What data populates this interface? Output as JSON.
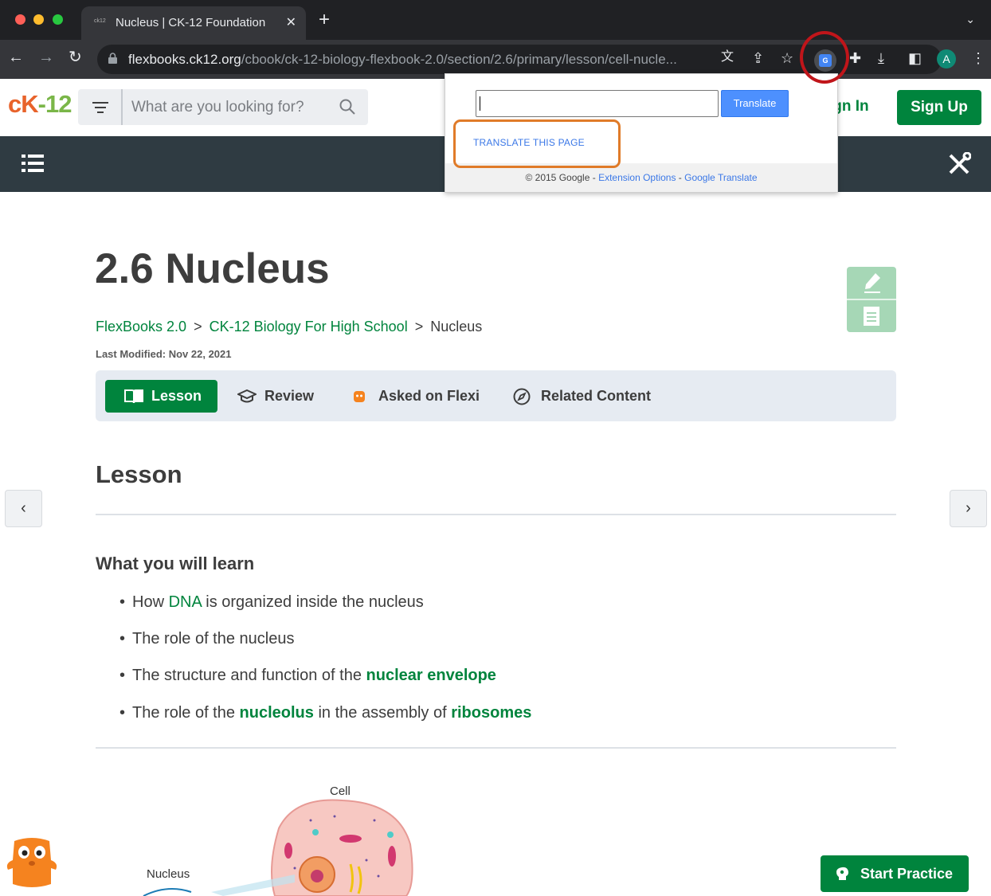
{
  "browser": {
    "tab": {
      "favicon_text": "ck12",
      "title": "Nucleus | CK-12 Foundation"
    },
    "new_tab": "+",
    "url_host": "flexbooks.ck12.org",
    "url_path": "/cbook/ck-12-biology-flexbook-2.0/section/2.6/primary/lesson/cell-nucle...",
    "profile_initial": "A",
    "ext_icon_text": "G"
  },
  "translate_popup": {
    "translate_button": "Translate",
    "translate_page": "TRANSLATE THIS PAGE",
    "copyright": "© 2015 Google - ",
    "extension_options": "Extension Options",
    "dash": " - ",
    "google_translate": "Google Translate"
  },
  "header": {
    "logo_ck": "cK",
    "logo_12": "-12",
    "search_placeholder": "What are you looking for?",
    "sign_in": "ign In",
    "sign_up": "Sign Up"
  },
  "content": {
    "title": "2.6 Nucleus",
    "breadcrumb": {
      "items": [
        "FlexBooks 2.0",
        "CK-12 Biology For High School"
      ],
      "separator": ">",
      "current": "Nucleus"
    },
    "last_modified_label": "Last Modified: ",
    "last_modified_value": "Nov 22, 2021",
    "tabs": [
      "Lesson",
      "Review",
      "Asked on Flexi",
      "Related Content"
    ],
    "lesson_heading": "Lesson",
    "learn_heading": "What you will learn",
    "bullets": {
      "b1_pre": "How ",
      "b1_kw": "DNA",
      "b1_post": " is organized inside the nucleus",
      "b2": "The role of the nucleus",
      "b3_pre": "The structure and function of the ",
      "b3_kw": "nuclear envelope",
      "b4_pre": "The role of the ",
      "b4_kw1": "nucleolus",
      "b4_mid": " in the assembly of ",
      "b4_kw2": "ribosomes"
    },
    "bullet_char": "•",
    "diagram_labels": {
      "cell": "Cell",
      "nucleus": "Nucleus"
    },
    "start_practice": "Start Practice"
  },
  "colors": {
    "brand_green": "#00843d",
    "dark_bar": "#2f3b42",
    "highlight_red": "#c0151a",
    "highlight_orange": "#e07b29"
  }
}
